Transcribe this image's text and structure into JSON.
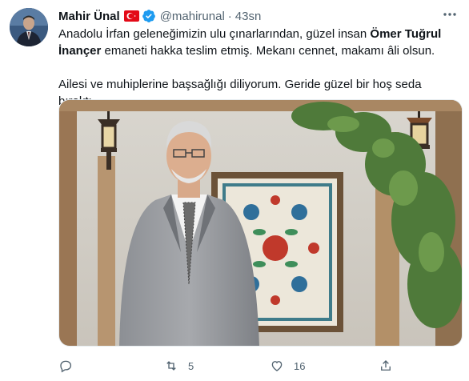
{
  "author": {
    "name": "Mahir Ünal",
    "handle": "@mahirunal",
    "time": "43sn",
    "separator": "·",
    "flag_icon": "turkey-flag-icon",
    "verified_icon": "verified-badge-icon"
  },
  "tweet": {
    "line1_a": "Anadolu İrfan geleneğimizin ulu çınarlarından, güzel insan ",
    "line1_bold": "Ömer Tuğrul İnançer",
    "line1_b": " emaneti hakka teslim etmiş. Mekanı cennet, makamı âli olsun.",
    "line2": "Ailesi ve muhiplerine başsağlığı diliyorum. Geride güzel bir hoş seda bıraktı."
  },
  "actions": {
    "reply_icon": "reply-icon",
    "retweet_icon": "retweet-icon",
    "retweet_count": "5",
    "like_icon": "heart-icon",
    "like_count": "16",
    "share_icon": "share-icon"
  },
  "colors": {
    "text": "#0f1419",
    "secondary": "#536471",
    "verified": "#1d9bf0",
    "flag": "#e30a17"
  }
}
